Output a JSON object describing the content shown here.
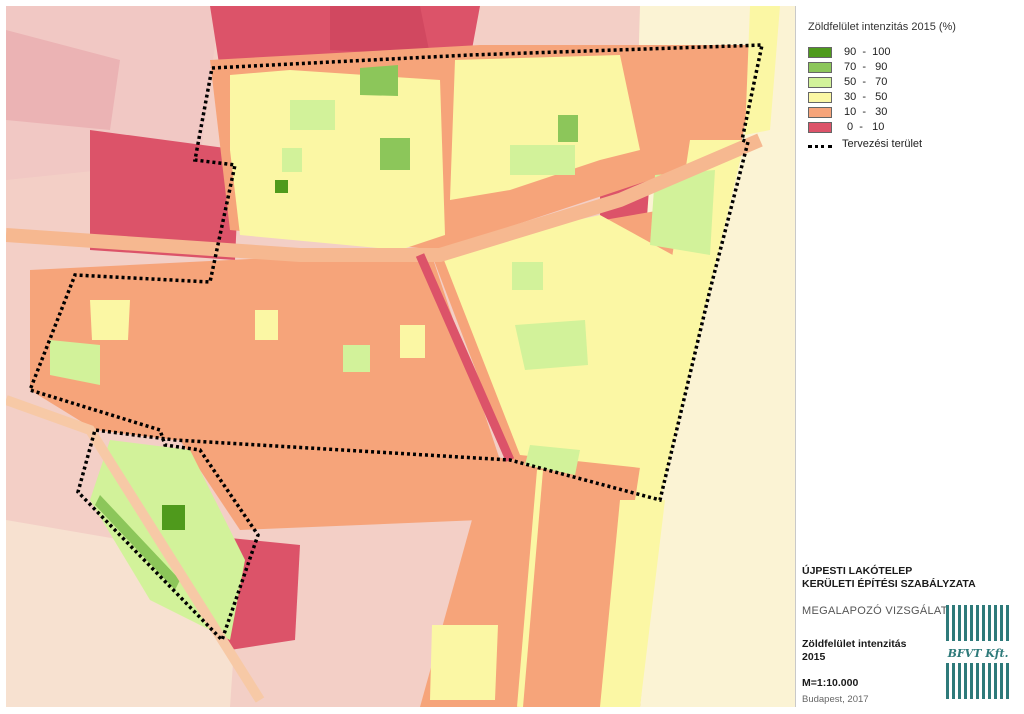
{
  "legend": {
    "title": "Zöldfelület intenzitás 2015 (%)",
    "items": [
      {
        "range": "90  -  100",
        "color": "#4f9a1c"
      },
      {
        "range": "70  -   90",
        "color": "#8cc65a"
      },
      {
        "range": "50  -   70",
        "color": "#d2f29a"
      },
      {
        "range": "30  -   50",
        "color": "#fbf7a4"
      },
      {
        "range": "10  -   30",
        "color": "#f6a47a"
      },
      {
        "range": " 0  -   10",
        "color": "#dc5369"
      }
    ],
    "boundary_label": "Tervezési terület"
  },
  "info": {
    "title_line1": "ÚJPESTI LAKÓTELEP",
    "title_line2": "KERÜLETI ÉPÍTÉSI SZABÁLYZATA",
    "subtitle": "MEGALAPOZÓ VIZSGÁLAT",
    "map_title_line1": "Zöldfelület intenzitás",
    "map_title_line2": "2015",
    "scale": "M=1:10.000",
    "place": "Budapest, 2017"
  },
  "logo": {
    "text": "BFVT Kft.",
    "color": "#2e7a7a"
  }
}
